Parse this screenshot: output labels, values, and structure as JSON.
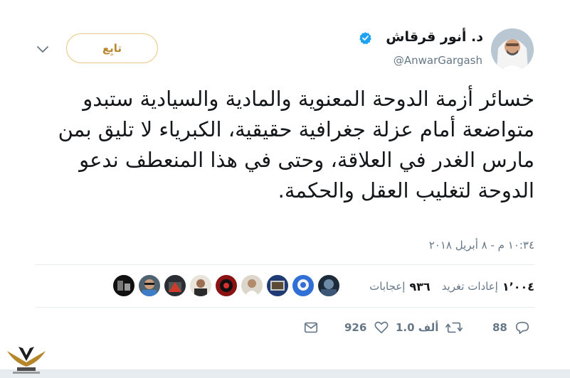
{
  "author": {
    "name": "د. أنور قرقاش",
    "handle": "@AnwarGargash",
    "verified": true
  },
  "follow_label": "تابِع",
  "tweet_text": "خسائر أزمة الدوحة المعنوية والمادية والسيادية ستبدو متواضعة أمام عزلة جغرافية حقيقية، الكبرياء لا تليق بمن مارس الغدر في العلاقة، وحتى في هذا المنعطف ندعو الدوحة لتغليب العقل والحكمة.",
  "timestamp": "١٠:٣٤ م - ٨ أبريل ٢٠١٨",
  "stats": {
    "retweets_value": "١٬٠٠٤",
    "retweets_label": "إعادات تغريد",
    "likes_value": "٩٣٦",
    "likes_label": "إعجابات"
  },
  "actions": {
    "replies": "88",
    "retweets": "1.0 ألف",
    "likes": "926"
  },
  "colors": {
    "follow_border": "#e7c67f",
    "follow_text": "#b8872e",
    "verified_blue": "#1da1f2",
    "muted": "#657786",
    "text": "#14171a"
  },
  "icons": [
    "verified-badge-icon",
    "chevron-down-icon",
    "reply-icon",
    "retweet-icon",
    "like-icon",
    "message-icon"
  ]
}
